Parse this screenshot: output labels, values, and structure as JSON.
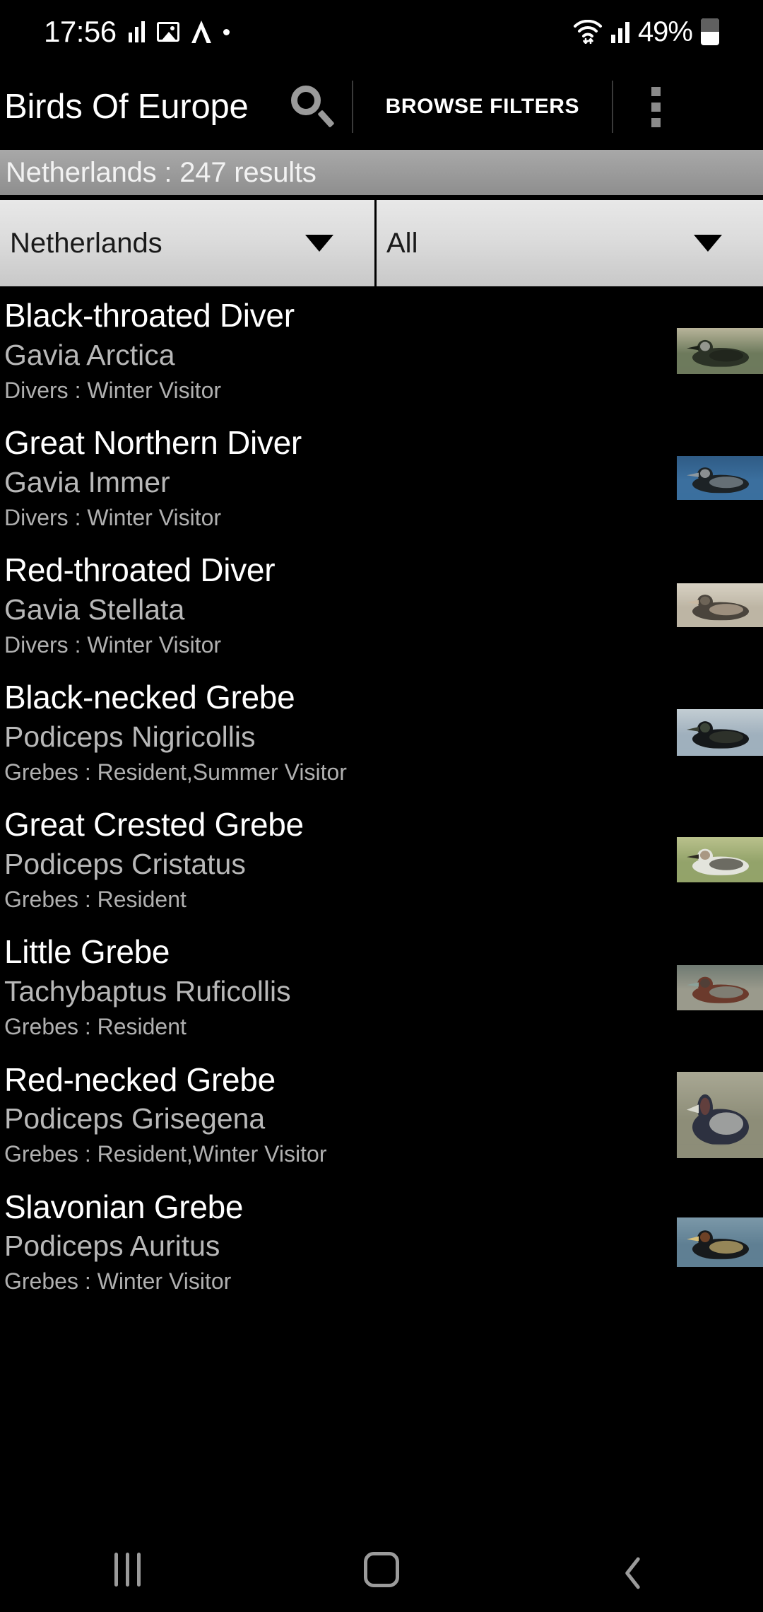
{
  "status_bar": {
    "time": "17:56",
    "battery_percent": "49%",
    "battery_level": 49,
    "icons": [
      "equalizer-icon",
      "photo-icon",
      "app-caret-icon",
      "dot-icon",
      "wifi-icon",
      "cell-signal-icon",
      "battery-icon"
    ]
  },
  "app_bar": {
    "title": "Birds Of Europe",
    "search_icon": "search-icon",
    "browse_filters_label": "BROWSE FILTERS",
    "overflow_icon": "overflow-menu-icon"
  },
  "results_bar": {
    "text": "Netherlands : 247 results",
    "region": "Netherlands",
    "count": 247,
    "count_label": "results"
  },
  "filters": {
    "country": {
      "value": "Netherlands",
      "caret_icon": "chevron-down-icon"
    },
    "category": {
      "value": "All",
      "caret_icon": "chevron-down-icon"
    }
  },
  "list": {
    "items": [
      {
        "name": "Black-throated Diver",
        "latin": "Gavia Arctica",
        "meta": "Divers : Winter Visitor",
        "family": "Divers",
        "status": "Winter Visitor",
        "thumb_height": 65,
        "thumb_colors": [
          "#6d7a5c",
          "#b8b49a",
          "#2b3226",
          "#e9e9e4",
          "#1b2018"
        ]
      },
      {
        "name": "Great Northern Diver",
        "latin": "Gavia Immer",
        "meta": "Divers : Winter Visitor",
        "family": "Divers",
        "status": "Winter Visitor",
        "thumb_height": 62,
        "thumb_colors": [
          "#3b6f9e",
          "#2f5b85",
          "#1d2326",
          "#e6e9ea",
          "#8c98a0"
        ]
      },
      {
        "name": "Red-throated Diver",
        "latin": "Gavia Stellata",
        "meta": "Divers : Winter Visitor",
        "family": "Divers",
        "status": "Winter Visitor",
        "thumb_height": 62,
        "thumb_colors": [
          "#bdb5a4",
          "#d8d2c4",
          "#4a443c",
          "#8a7f6e",
          "#c9b9a2"
        ]
      },
      {
        "name": "Black-necked Grebe",
        "latin": "Podiceps Nigricollis",
        "meta": "Grebes : Resident,Summer Visitor",
        "family": "Grebes",
        "status": "Resident,Summer Visitor",
        "thumb_height": 66,
        "thumb_colors": [
          "#9fb0bd",
          "#c3cdd3",
          "#15181a",
          "#5c6b52",
          "#3a3f33"
        ]
      },
      {
        "name": "Great Crested Grebe",
        "latin": "Podiceps Cristatus",
        "meta": "Grebes : Resident",
        "family": "Grebes",
        "status": "Resident",
        "thumb_height": 64,
        "thumb_colors": [
          "#93a36a",
          "#b9c18c",
          "#e3e4dc",
          "#7a5a3a",
          "#2d2a20"
        ]
      },
      {
        "name": "Little Grebe",
        "latin": "Tachybaptus Ruficollis",
        "meta": "Grebes : Resident",
        "family": "Grebes",
        "status": "Resident",
        "thumb_height": 64,
        "thumb_colors": [
          "#9a9a8c",
          "#6f7a72",
          "#6b3a2c",
          "#3d4442",
          "#8ba199"
        ]
      },
      {
        "name": "Red-necked Grebe",
        "latin": "Podiceps Grisegena",
        "meta": "Grebes : Resident,Winter Visitor",
        "family": "Grebes",
        "status": "Resident,Winter Visitor",
        "thumb_height": 122,
        "thumb_colors": [
          "#8d8d78",
          "#a9a894",
          "#2d3140",
          "#8d4a3a",
          "#d9d9cf"
        ]
      },
      {
        "name": "Slavonian Grebe",
        "latin": "Podiceps Auritus",
        "meta": "Grebes : Winter Visitor",
        "family": "Grebes",
        "status": "Winter Visitor",
        "thumb_height": 70,
        "thumb_colors": [
          "#5f7f93",
          "#7b98a8",
          "#171a1c",
          "#b5622f",
          "#d8c07a"
        ]
      }
    ]
  },
  "nav_bar": {
    "recents_label": "recents-icon",
    "home_label": "home-icon",
    "back_label": "back-icon"
  }
}
